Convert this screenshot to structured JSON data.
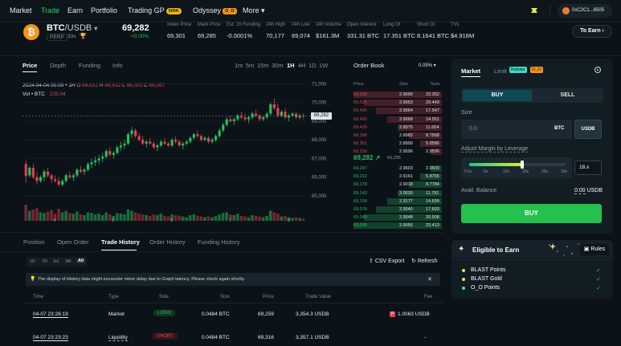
{
  "nav": {
    "items": [
      "Market",
      "Trade",
      "Earn",
      "Portfolio",
      "Trading GP",
      "Odyssey",
      "More ▾"
    ],
    "trading_badge": "500K",
    "odyssey_badge": "O_O",
    "wallet": "0xC2C1...8505"
  },
  "ticker": {
    "symbol_base": "BTC",
    "symbol_quote": "/USDB",
    "perp": "PERP",
    "leverage": "33x",
    "price": "69,282",
    "change": "+0.00%",
    "stats": [
      {
        "label": "Index Price",
        "value": "69,301"
      },
      {
        "label": "Mark Price",
        "value": "69,285"
      },
      {
        "label": "Est. 1h Funding",
        "value": "-0.0001%"
      },
      {
        "label": "24h High",
        "value": "70,177"
      },
      {
        "label": "24h Low",
        "value": "69,074"
      },
      {
        "label": "24h Volume",
        "value": "$161.3M"
      },
      {
        "label": "Open Interest",
        "value": "331.31 BTC"
      },
      {
        "label": "Long OI",
        "value": "17.351 BTC"
      },
      {
        "label": "Short OI",
        "value": "8.1641 BTC"
      },
      {
        "label": "TVL",
        "value": "$4.918M"
      }
    ],
    "to_earn": "To Earn ›"
  },
  "chart_tabs": {
    "left": [
      "Price",
      "Depth",
      "Funding",
      "Info"
    ],
    "intervals": [
      "1m",
      "5m",
      "15m",
      "30m",
      "1H",
      "4H",
      "1D",
      "1W"
    ]
  },
  "chart_info": {
    "ohlc_prefix": "2024-04-04 00:00 • 1H",
    "o": "66,632",
    "h": "66,632",
    "l": "66,002",
    "c": "66,067",
    "vol_label": "Vol • BTC",
    "vol": "225.04",
    "price_line_label": "69,282"
  },
  "chart_data": {
    "type": "candlestick",
    "y_ticks": [
      "71,000",
      "70,000",
      "69,000",
      "68,000",
      "67,000",
      "66,000",
      "65,000"
    ],
    "ylim": [
      64700,
      71100
    ],
    "x_ticks": [
      "4",
      "5",
      "6",
      "7",
      "8"
    ],
    "candles": [
      [
        66700,
        66900,
        65700,
        66067
      ],
      [
        66100,
        66600,
        66000,
        66500
      ],
      [
        66500,
        66700,
        65900,
        66000
      ],
      [
        66000,
        66300,
        65600,
        65800
      ],
      [
        65800,
        66100,
        65700,
        66000
      ],
      [
        66000,
        66400,
        65800,
        66300
      ],
      [
        66300,
        66500,
        66000,
        66100
      ],
      [
        66100,
        66200,
        65700,
        65900
      ],
      [
        65900,
        66100,
        65700,
        65800
      ],
      [
        65800,
        66000,
        65500,
        65600
      ],
      [
        65600,
        65900,
        65500,
        65800
      ],
      [
        65800,
        66200,
        65700,
        66100
      ],
      [
        66100,
        66300,
        65900,
        66000
      ],
      [
        66000,
        66200,
        65800,
        66100
      ],
      [
        66100,
        66500,
        66000,
        66400
      ],
      [
        66400,
        66600,
        66200,
        66300
      ],
      [
        66300,
        66500,
        66100,
        66400
      ],
      [
        66400,
        66800,
        66300,
        66700
      ],
      [
        66700,
        67000,
        66500,
        66800
      ],
      [
        66800,
        67100,
        66600,
        66900
      ],
      [
        66900,
        67200,
        66700,
        67000
      ],
      [
        67000,
        67300,
        66800,
        67100
      ],
      [
        67100,
        67500,
        67000,
        67400
      ],
      [
        67400,
        67600,
        67100,
        67200
      ],
      [
        67200,
        67400,
        67000,
        67300
      ],
      [
        67300,
        67700,
        67200,
        67600
      ],
      [
        67600,
        67900,
        67400,
        67700
      ],
      [
        67700,
        68000,
        67500,
        67800
      ],
      [
        67800,
        68400,
        67700,
        68300
      ],
      [
        68300,
        68700,
        68100,
        68500
      ],
      [
        68500,
        68600,
        68100,
        68200
      ],
      [
        68200,
        68400,
        67900,
        68000
      ],
      [
        68000,
        68200,
        67700,
        67800
      ],
      [
        67800,
        68000,
        67600,
        67900
      ],
      [
        67900,
        68100,
        67700,
        67800
      ],
      [
        67800,
        67900,
        67500,
        67600
      ],
      [
        67600,
        67800,
        67400,
        67700
      ],
      [
        67700,
        68000,
        67600,
        67900
      ],
      [
        67900,
        68100,
        67700,
        67800
      ],
      [
        67800,
        67900,
        67600,
        67700
      ],
      [
        67700,
        68100,
        67600,
        68000
      ],
      [
        68000,
        68200,
        67800,
        67900
      ],
      [
        67900,
        68000,
        67600,
        67700
      ],
      [
        67700,
        67900,
        67500,
        67800
      ],
      [
        67800,
        68000,
        67700,
        67900
      ],
      [
        67900,
        68200,
        67800,
        68100
      ],
      [
        68100,
        68400,
        68000,
        68300
      ],
      [
        68300,
        68500,
        68100,
        68200
      ],
      [
        68200,
        68300,
        67900,
        68000
      ],
      [
        68000,
        68200,
        67900,
        68100
      ],
      [
        68100,
        68200,
        67800,
        67900
      ],
      [
        67900,
        68100,
        67800,
        68000
      ],
      [
        68000,
        68300,
        67900,
        68200
      ],
      [
        68200,
        68600,
        68100,
        68500
      ],
      [
        68500,
        68900,
        68400,
        68800
      ],
      [
        68800,
        69200,
        68700,
        69100
      ],
      [
        69100,
        69300,
        68900,
        69000
      ],
      [
        69000,
        69200,
        68800,
        69100
      ],
      [
        69100,
        69400,
        69000,
        69300
      ],
      [
        69300,
        69500,
        69100,
        69200
      ],
      [
        69200,
        69400,
        69000,
        69100
      ],
      [
        69100,
        69300,
        68900,
        69200
      ],
      [
        69200,
        69500,
        69100,
        69400
      ],
      [
        69400,
        69600,
        69200,
        69300
      ],
      [
        69300,
        69400,
        69000,
        69100
      ],
      [
        69100,
        69300,
        69000,
        69200
      ],
      [
        69200,
        69500,
        69100,
        69400
      ],
      [
        69400,
        70000,
        69300,
        69900
      ],
      [
        69900,
        70200,
        69600,
        69700
      ],
      [
        69700,
        69900,
        69200,
        69300
      ],
      [
        69300,
        69600,
        69200,
        69500
      ],
      [
        69500,
        69700,
        69100,
        69200
      ],
      [
        69200,
        69400,
        69000,
        69300
      ],
      [
        69300,
        69500,
        69200,
        69400
      ],
      [
        69400,
        69500,
        69100,
        69200
      ],
      [
        69200,
        69400,
        69100,
        69300
      ],
      [
        69300,
        69400,
        69100,
        69282
      ]
    ],
    "volumes": [
      225,
      140,
      160,
      180,
      120,
      110,
      130,
      150,
      100,
      170,
      120,
      140,
      110,
      100,
      130,
      90,
      80,
      120,
      110,
      90,
      100,
      80,
      120,
      90,
      70,
      110,
      100,
      90,
      160,
      140,
      120,
      100,
      90,
      80,
      70,
      90,
      80,
      100,
      70,
      60,
      90,
      80,
      70,
      60,
      50,
      80,
      90,
      70,
      60,
      50,
      60,
      50,
      70,
      90,
      110,
      120,
      90,
      80,
      100,
      70,
      60,
      50,
      80,
      70,
      60,
      50,
      70,
      140,
      120,
      100,
      60,
      70,
      50,
      40,
      50,
      40,
      30
    ],
    "vol_max": 250
  },
  "orderbook": {
    "title": "Order Book",
    "precision": "0.05% ▾",
    "headers": [
      "Price",
      "Size",
      "Sum"
    ],
    "asks": [
      [
        "69,559",
        "2.9090",
        "23.352"
      ],
      [
        "69,525",
        "2.8953",
        "20.443"
      ],
      [
        "69,490",
        "2.9964",
        "17.547"
      ],
      [
        "69,455",
        "2.8968",
        "14.551"
      ],
      [
        "69,420",
        "2.8975",
        "11.654"
      ],
      [
        "69,386",
        "2.8982",
        "8.7568"
      ],
      [
        "69,351",
        "2.8990",
        "5.8586"
      ],
      [
        "69,316",
        "2.9596",
        "2.9596"
      ]
    ],
    "ask_depth": [
      1.0,
      0.88,
      0.75,
      0.62,
      0.5,
      0.37,
      0.25,
      0.13
    ],
    "mid_price": "69,282 ↗",
    "mid_mark": "69,285",
    "bids": [
      [
        "69,247",
        "2.9603",
        "2.9603"
      ],
      [
        "69,212",
        "2.9161",
        "5.8765"
      ],
      [
        "69,178",
        "2.9018",
        "8.7784"
      ],
      [
        "69,143",
        "3.0030",
        "11.781"
      ],
      [
        "69,109",
        "2.9177",
        "14.699"
      ],
      [
        "69,074",
        "2.9040",
        "17.603"
      ],
      [
        "69,040",
        "2.9048",
        "20.508"
      ],
      [
        "69,005",
        "2.9055",
        "23.413"
      ]
    ],
    "bid_depth": [
      0.13,
      0.25,
      0.37,
      0.5,
      0.62,
      0.75,
      0.88,
      1.0
    ]
  },
  "trade": {
    "tabs": [
      "Market",
      "Limit"
    ],
    "rebate": "Rebate",
    "limit_badge": "O_O",
    "buy": "BUY",
    "sell": "SELL",
    "size_label": "Size",
    "size_placeholder": "0.0",
    "unit_btc": "BTC",
    "unit_usdb": "USDB",
    "leverage_label": "Adjust Margin by Leverage",
    "lev_ticks": [
      "0.1x",
      "6x",
      "13x",
      "19x",
      "26x",
      "33x"
    ],
    "lev_value": "18.x",
    "lev_fraction": 0.55,
    "balance_label": "Avail. Balance",
    "balance_value": "0.00",
    "balance_unit": "USDB",
    "submit": "BUY"
  },
  "earn": {
    "title": "Eligible to Earn",
    "rules": "Rules",
    "items": [
      "BLAST Points",
      "BLAST Gold",
      "O_O Points"
    ],
    "check": "✓"
  },
  "bottom": {
    "tabs": [
      "Position",
      "Open Order",
      "Trade History",
      "Order History",
      "Funding History"
    ],
    "ranges": [
      "1D",
      "7D",
      "1H",
      "3M",
      "All"
    ],
    "csv": "CSV Export",
    "refresh": "Refresh",
    "notice": "The display of History data might encounter minor delay due to Graph latency. Please check again shortly.",
    "close": "✕",
    "headers": [
      "Time",
      "Type",
      "Side",
      "Size",
      "Price",
      "Trade Value",
      "Fee"
    ],
    "rows": [
      [
        "04-07 23:26:19",
        "Market",
        "LONG",
        "0.0484 BTC",
        "69,259",
        "3,354.3 USDB",
        "1.0063 USDB"
      ],
      [
        "04-07 23:23:23",
        "Liquidity",
        "SHORT",
        "0.0484 BTC",
        "69,316",
        "3,357.1 USDB",
        "-"
      ]
    ]
  },
  "colors": {
    "up": "#2bbd5c",
    "down": "#e0414f",
    "accent": "#25c04e",
    "link": "#3aa3ff",
    "bg": "#0b1319"
  }
}
